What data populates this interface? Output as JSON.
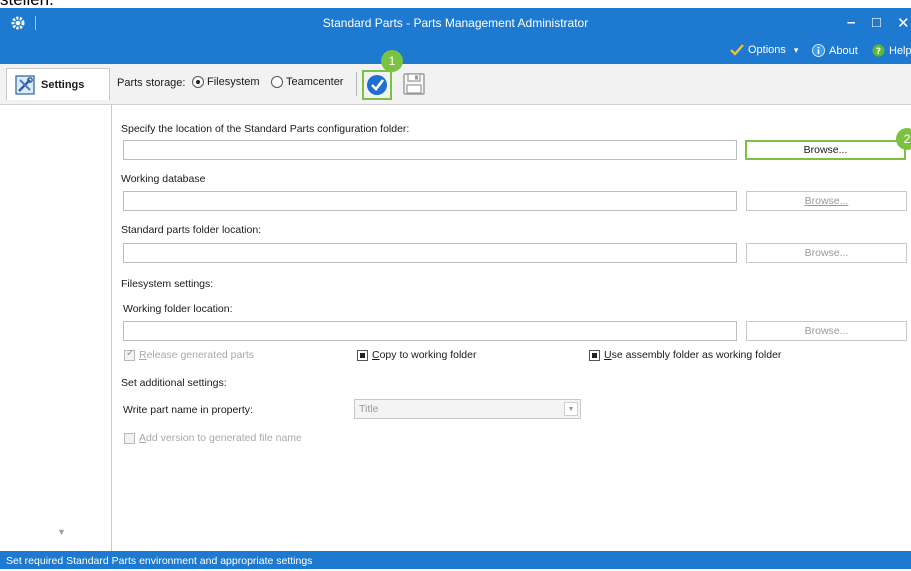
{
  "top_cut_text": "stellen.",
  "window": {
    "title": "Standard Parts - Parts Management Administrator",
    "minimize": "–",
    "maximize": "□",
    "close": "✕"
  },
  "menu": {
    "options": "Options",
    "options_arrow": "▾",
    "about": "About",
    "help": "Help"
  },
  "sidebar": {
    "tab_label": "Settings"
  },
  "toolbar": {
    "storage_label": "Parts storage:",
    "radio_filesystem": "Filesystem",
    "radio_teamcenter": "Teamcenter",
    "selected_storage": "Filesystem"
  },
  "callouts": {
    "one": "1",
    "two": "2"
  },
  "form": {
    "config_folder_label": "Specify the location of the Standard Parts configuration folder:",
    "config_folder_value": "",
    "browse_label": "Browse...",
    "working_db_label": "Working database",
    "working_db_value": "",
    "std_folder_label": "Standard parts folder location:",
    "std_folder_value": "",
    "fs_settings_label": "Filesystem settings:",
    "working_folder_label": "Working folder location:",
    "working_folder_value": "",
    "release_generated_first": "R",
    "release_generated_rest": "elease generated parts",
    "copy_working_first": "C",
    "copy_working_rest": "opy to working folder",
    "use_assembly_first": "U",
    "use_assembly_rest": "se assembly folder as working folder",
    "additional_label": "Set additional settings:",
    "write_part_label": "Write part name in property:",
    "write_part_value": "Title",
    "add_version_first": "A",
    "add_version_rest": "dd version to generated file name"
  },
  "statusbar": {
    "text": "Set required Standard Parts environment and appropriate settings"
  },
  "colors": {
    "accent_blue": "#1e7ad0",
    "callout_green": "#7cc242"
  }
}
